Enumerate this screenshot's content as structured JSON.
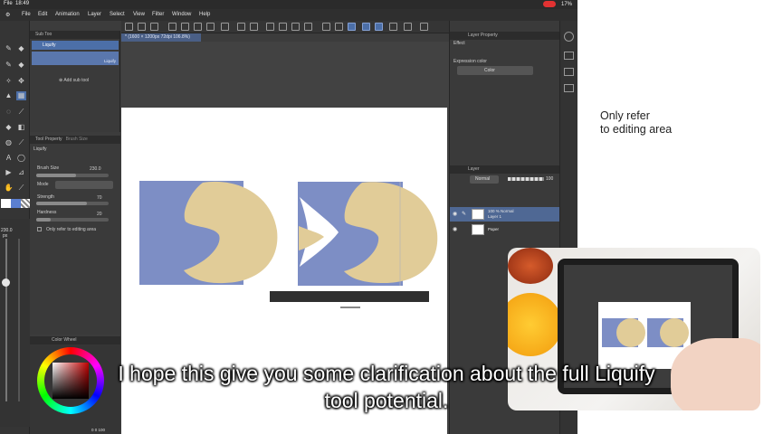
{
  "status_bar": {
    "app_name": "File",
    "time": "18:49",
    "battery": "17%"
  },
  "menu": {
    "items": [
      "File",
      "Edit",
      "Animation",
      "Layer",
      "Select",
      "View",
      "Filter",
      "Window",
      "Help"
    ]
  },
  "document": {
    "tab_label": "* (1600 × 1200px 72dpi 106.8%)"
  },
  "sub_tool": {
    "header": "Sub Too",
    "selected_group": "Liquify",
    "selected_tool": "Liquify",
    "add_label": "Add sub tool"
  },
  "tool_property": {
    "header": "Tool Property",
    "secondary_header": "Brush Size",
    "tool_name": "Liquify",
    "brush_size_label": "Brush Size",
    "brush_size_value": "230.0",
    "mode_label": "Mode",
    "strength_label": "Strength",
    "strength_value": "70",
    "strength_fraction": 0.7,
    "hardness_label": "Hardness",
    "hardness_value": "20",
    "hardness_fraction": 0.2,
    "editing_area_label": "Only refer to editing area"
  },
  "size_bar": {
    "value": "230.0",
    "unit": "px"
  },
  "color_panel": {
    "header": "Color Wheel",
    "readout": "0 0 100"
  },
  "layer_property": {
    "header": "Layer Property",
    "effect_label": "Effect",
    "expression_color_label": "Expression color",
    "expression_color_value": "Color"
  },
  "layer_panel": {
    "header": "Layer",
    "blend_mode": "Normal",
    "opacity": "100",
    "layers": [
      {
        "line1": "100 % Normal",
        "line2": "Layer 1",
        "selected": true
      },
      {
        "line1": "Paper",
        "line2": "",
        "selected": false
      }
    ]
  },
  "annotation": {
    "text": "Only refer\nto editing area"
  },
  "subtitle": {
    "line1": "I hope this give you some clarification about the full Liquify",
    "line2": "tool potential."
  },
  "colors": {
    "accent": "#4c6fa8",
    "shape_blue": "#7d8ec5",
    "shape_tan": "#e1cc98"
  }
}
